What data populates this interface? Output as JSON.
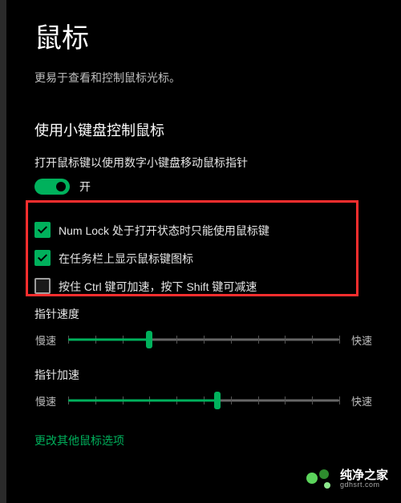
{
  "page": {
    "title": "鼠标",
    "description": "更易于查看和控制鼠标光标。"
  },
  "keypad": {
    "heading": "使用小键盘控制鼠标",
    "toggle_desc": "打开鼠标键以使用数字小键盘移动鼠标指针",
    "toggle_state": "开",
    "cb_numlock": "Num Lock 处于打开状态时只能使用鼠标键",
    "cb_taskbar": "在任务栏上显示鼠标键图标",
    "cb_ctrlshift": "按住 Ctrl 键可加速，按下 Shift 键可减速"
  },
  "sliders": {
    "speed_label": "指针速度",
    "accel_label": "指针加速",
    "low": "慢速",
    "high": "快速"
  },
  "link": {
    "other_options": "更改其他鼠标选项"
  },
  "watermark": {
    "title": "纯净之家",
    "url": "gdhsrt.com"
  }
}
